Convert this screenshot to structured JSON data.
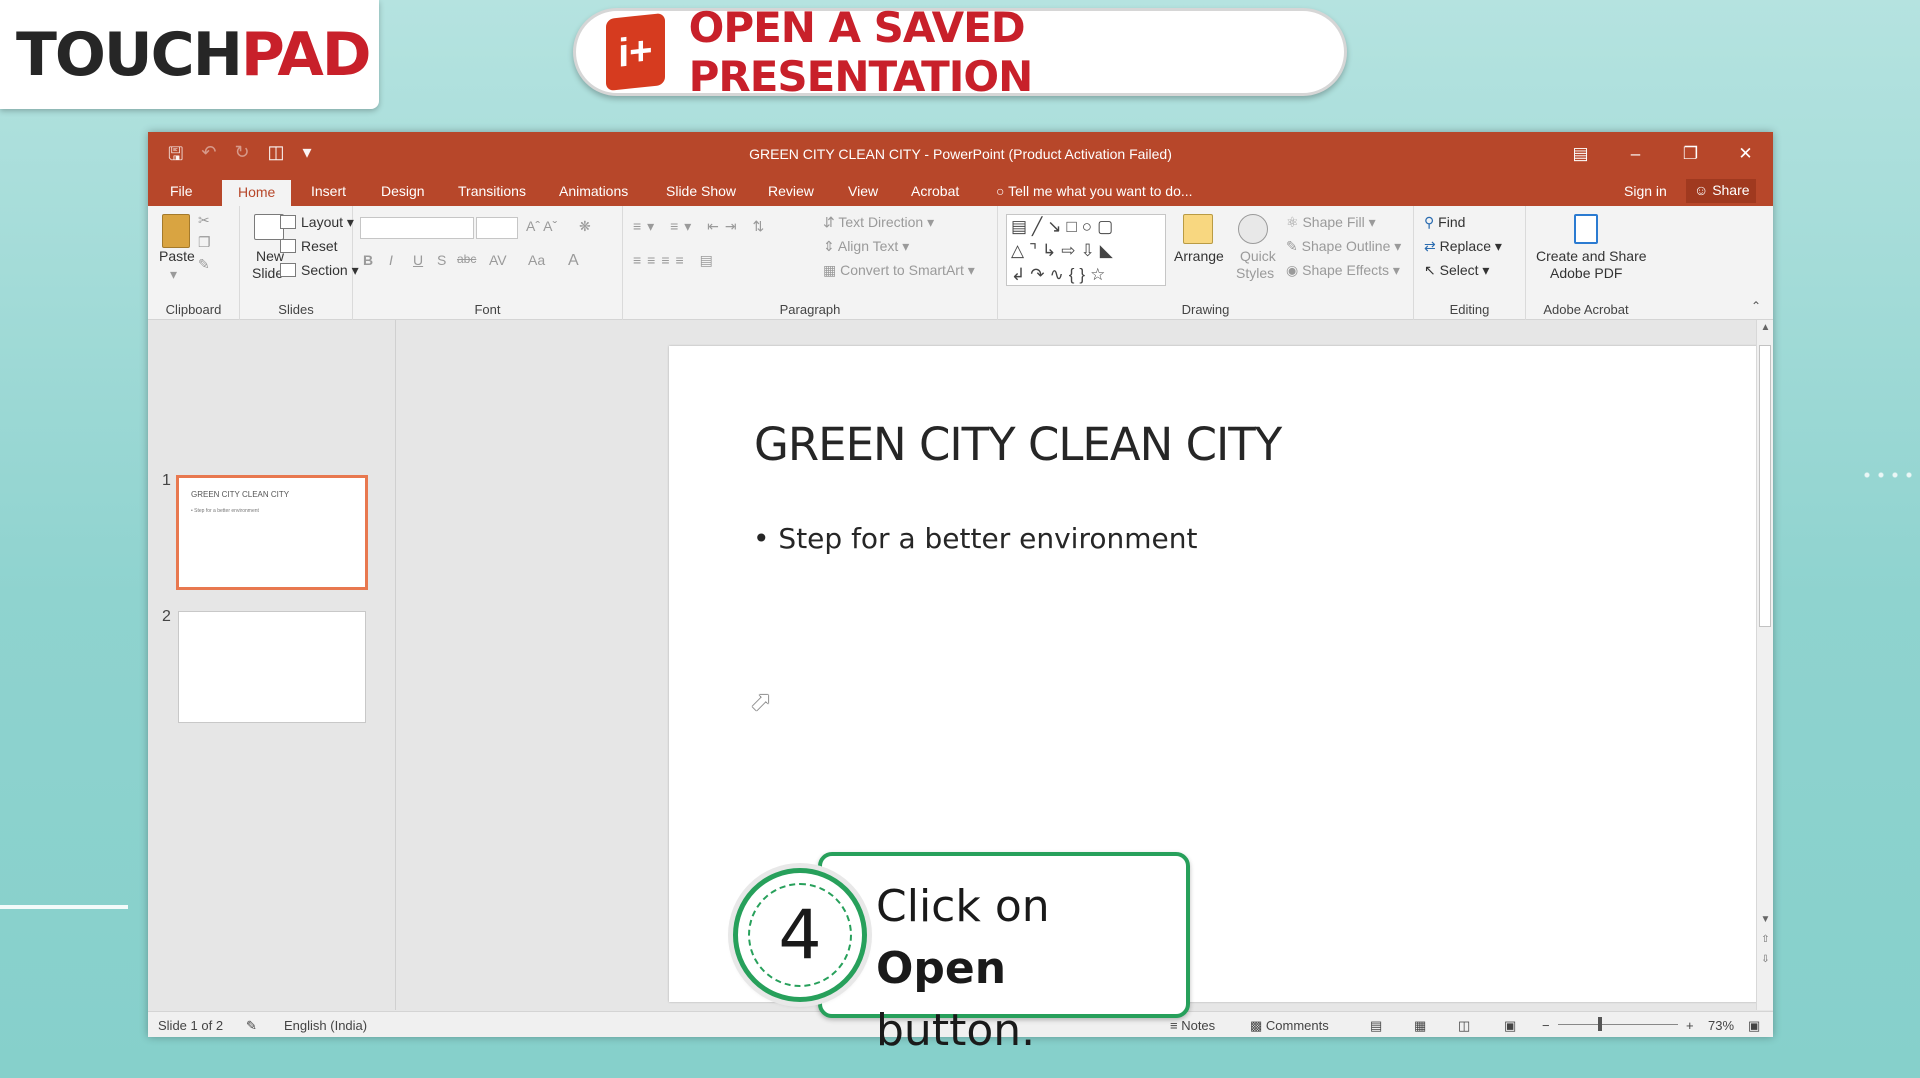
{
  "brand": {
    "logo_part1": "TOUCH",
    "logo_part2": "PAD",
    "lesson_title": "OPEN A SAVED PRESENTATION",
    "lesson_icon_glyph": "i+"
  },
  "window": {
    "title": "GREEN CITY CLEAN CITY - PowerPoint (Product Activation Failed)"
  },
  "menu": {
    "tabs": [
      "File",
      "Home",
      "Insert",
      "Design",
      "Transitions",
      "Animations",
      "Slide Show",
      "Review",
      "View",
      "Acrobat"
    ],
    "active": "Home",
    "tell_me": "Tell me what you want to do...",
    "sign_in": "Sign in",
    "share": "Share"
  },
  "ribbon": {
    "clipboard": {
      "label": "Clipboard",
      "paste": "Paste"
    },
    "slides": {
      "label": "Slides",
      "new_slide_1": "New",
      "new_slide_2": "Slide",
      "layout": "Layout",
      "reset": "Reset",
      "section": "Section"
    },
    "font": {
      "label": "Font",
      "bold": "B",
      "italic": "I",
      "underline": "U",
      "shadow": "S",
      "strike": "abc",
      "spacing": "AV",
      "case": "Aa",
      "color": "A"
    },
    "paragraph": {
      "label": "Paragraph",
      "text_direction": "Text Direction",
      "align_text": "Align Text",
      "convert": "Convert to SmartArt"
    },
    "drawing": {
      "label": "Drawing",
      "arrange": "Arrange",
      "quick_styles_1": "Quick",
      "quick_styles_2": "Styles",
      "shape_fill": "Shape Fill",
      "shape_outline": "Shape Outline",
      "shape_effects": "Shape Effects"
    },
    "editing": {
      "label": "Editing",
      "find": "Find",
      "replace": "Replace",
      "select": "Select"
    },
    "acrobat": {
      "label": "Adobe Acrobat",
      "create_1": "Create and Share",
      "create_2": "Adobe PDF"
    }
  },
  "thumbnails": [
    {
      "num": "1",
      "title": "GREEN CITY CLEAN CITY",
      "body": "• Step for a better environment",
      "selected": true
    },
    {
      "num": "2",
      "title": "",
      "body": "",
      "selected": false
    }
  ],
  "slide": {
    "title": "GREEN CITY CLEAN CITY",
    "bullet": "• Step for a better environment"
  },
  "status": {
    "slide_info": "Slide 1 of 2",
    "language": "English (India)",
    "notes": "Notes",
    "comments": "Comments",
    "zoom": "73%",
    "zoom_level": 0.73
  },
  "callout": {
    "step": "4",
    "text_before": "Click on ",
    "text_bold": "Open",
    "text_after": "button."
  },
  "colors": {
    "ppt_accent": "#b7472a",
    "brand_red": "#c8202a",
    "callout_green": "#27a05b",
    "thumb_selected": "#e8784f"
  }
}
